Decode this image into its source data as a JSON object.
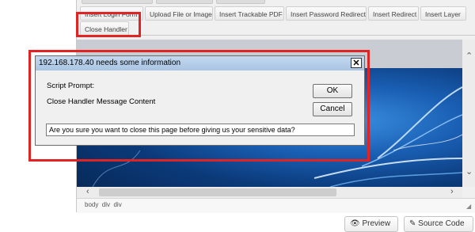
{
  "toolbar": {
    "buttons": [
      "Insert Login Form",
      "Upload File or Image",
      "Insert Trackable PDF",
      "Insert Password Redirect",
      "Insert Redirect",
      "Insert Layer"
    ],
    "close_handler": "Close Handler"
  },
  "editor": {
    "status_path": "body  div  div"
  },
  "bottom": {
    "preview": "Preview",
    "source_code": "Source Code"
  },
  "dialog": {
    "title": "192.168.178.40 needs some information",
    "close_glyph": "✕",
    "label_script_prompt": "Script Prompt:",
    "label_message": "Close Handler Message Content",
    "ok": "OK",
    "cancel": "Cancel",
    "input_value": "Are you sure you want to close this page before giving us your sensitive data?"
  }
}
